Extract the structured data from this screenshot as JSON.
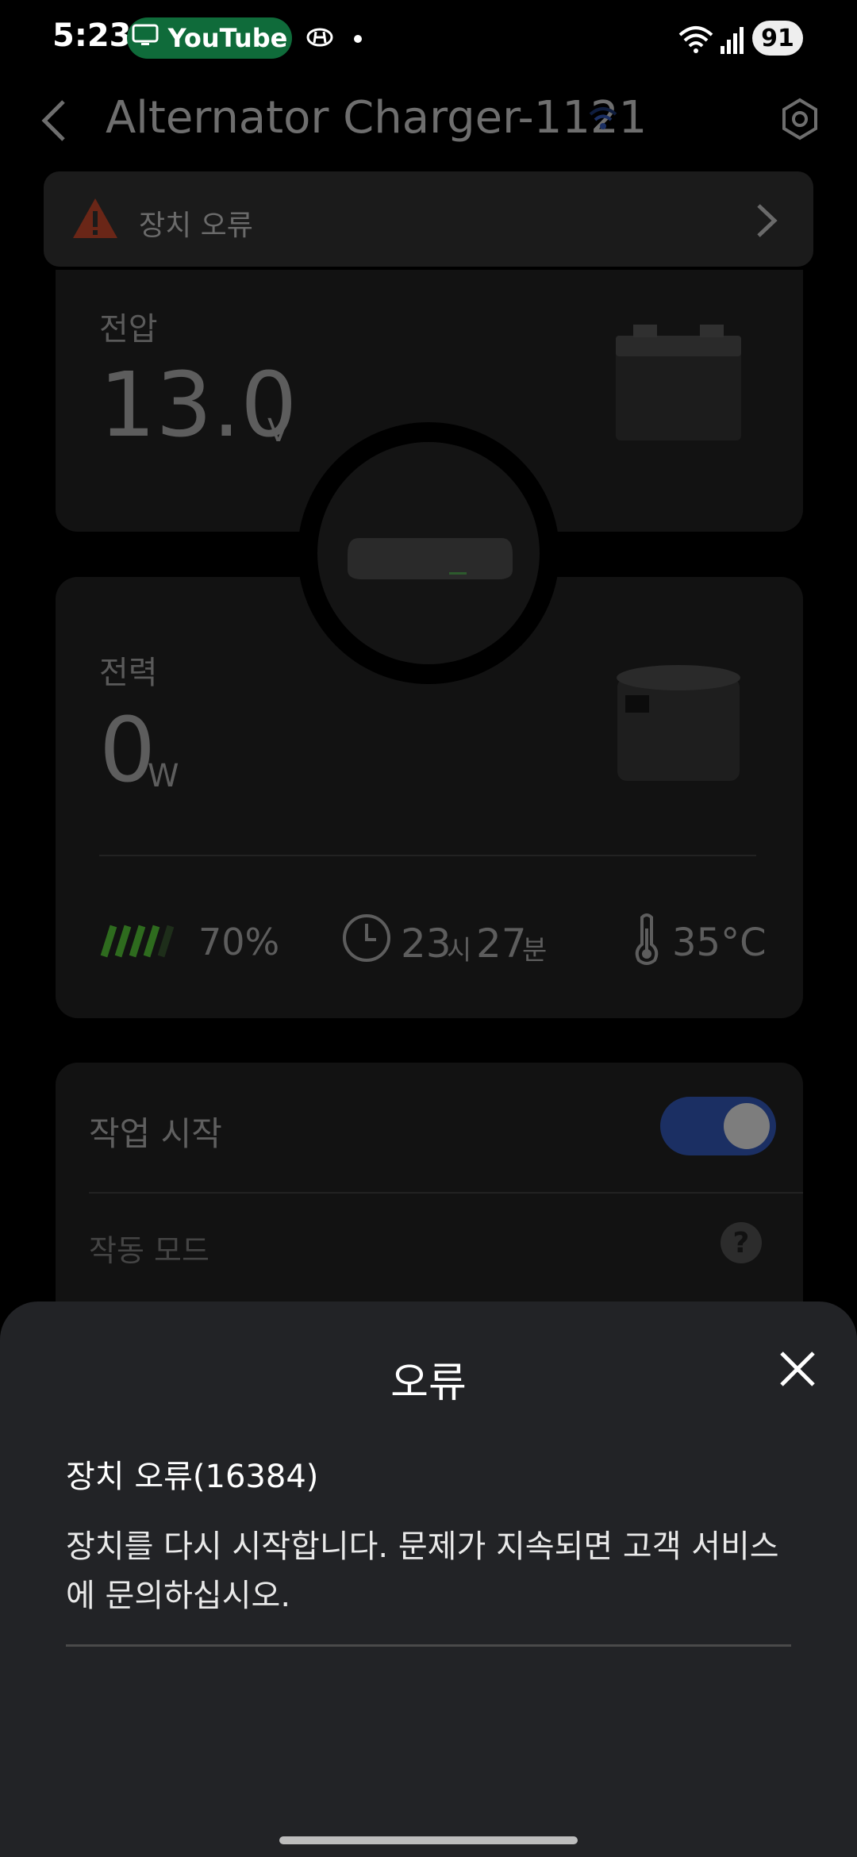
{
  "status_bar": {
    "time": "5:23",
    "app_badge": "YouTube",
    "battery": "91"
  },
  "header": {
    "title": "Alternator Charger-1121"
  },
  "error_banner": {
    "text": "장치 오류"
  },
  "voltage": {
    "label": "전압",
    "value": "13.0",
    "unit": "V"
  },
  "power": {
    "label": "전력",
    "value": "0",
    "unit": "W"
  },
  "stats": {
    "battery_percent": "70%",
    "remaining_hours": "23",
    "hours_label": "시",
    "remaining_minutes": "27",
    "minutes_label": "분",
    "temperature": "35°C"
  },
  "operations": {
    "job_label": "작업 시작",
    "job_toggle_on": true,
    "mode_label": "작동 모드"
  },
  "sheet": {
    "title": "오류",
    "error_title": "장치 오류(16384)",
    "error_description": "장치를 다시 시작합니다. 문제가 지속되면 고객 서비스에 문의하십시오."
  },
  "colors": {
    "accent": "#1b2f63",
    "status_green": "#0f6b3a",
    "warning": "#b3341e"
  }
}
